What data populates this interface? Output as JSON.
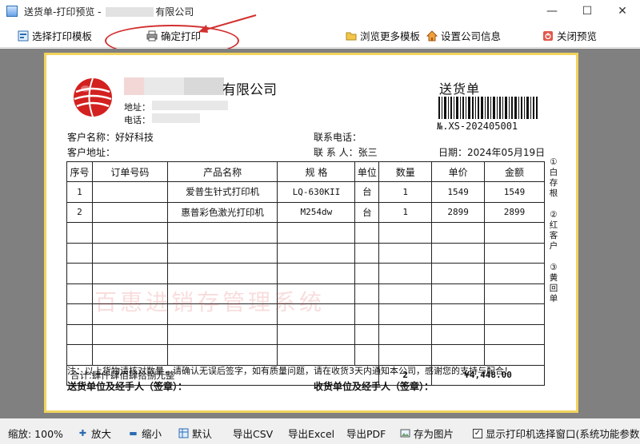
{
  "window": {
    "title_prefix": "送货单-打印预览 - ",
    "title_suffix": "有限公司",
    "minimize": "—",
    "maximize": "☐",
    "close": "✕"
  },
  "toolbar": {
    "select_template": "选择打印模板",
    "confirm_print": "确定打印",
    "browse_templates": "浏览更多模板",
    "company_info": "设置公司信息",
    "close_preview": "关闭预览"
  },
  "document": {
    "company_name": "有限公司",
    "address_label": "地址：",
    "phone_label": "电话：",
    "doc_title": "送货单",
    "doc_number": "№.XS-202405001",
    "customer_name_label": "客户名称：",
    "customer_name": "好好科技",
    "customer_address_label": "客户地址：",
    "contact_phone_label": "联系电话：",
    "contact_person_label": "联 系 人：",
    "contact_person": "张三",
    "date_label": "日期：",
    "date": "2024年05月19日",
    "columns": [
      "序号",
      "订单号码",
      "产品名称",
      "规 格",
      "单位",
      "数量",
      "单价",
      "金额"
    ],
    "rows": [
      {
        "no": "1",
        "order": "",
        "product": "爱普生针式打印机",
        "spec": "LQ-630KII",
        "unit": "台",
        "qty": "1",
        "price": "1549",
        "amount": "1549"
      },
      {
        "no": "2",
        "order": "",
        "product": "惠普彩色激光打印机",
        "spec": "M254dw",
        "unit": "台",
        "qty": "1",
        "price": "2899",
        "amount": "2899"
      }
    ],
    "total_label": "合计:肆仟肆佰肆拾捌元整",
    "total_qty": "2",
    "total_amount": "¥4,448.00",
    "watermark": "百惠进销存管理系统",
    "side_notes": [
      "①白存根",
      "②红客户",
      "③黄回单"
    ],
    "note": "注：以上货物请核对数量，请确认无误后签字，如有质量问题，请在收货3天内通知本公司，感谢您的支持与配合！",
    "sender_sign": "送货单位及经手人（签章）：",
    "receiver_sign": "收货单位及经手人（签章）："
  },
  "statusbar": {
    "zoom": "缩放: 100%",
    "zoom_in": "放大",
    "zoom_out": "缩小",
    "default": "默认",
    "export_csv": "导出CSV",
    "export_excel": "导出Excel",
    "export_pdf": "导出PDF",
    "save_image": "存为图片",
    "show_printer_dialog": "显示打印机选择窗口(系统功能参数)"
  },
  "colors": {
    "annotation": "#d32f2f",
    "paper_border": "#f1d35c",
    "preview_bg": "#808080"
  }
}
